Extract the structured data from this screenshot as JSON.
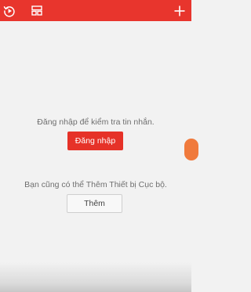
{
  "topbar": {
    "color": "#e8352d",
    "icons": {
      "left": "refresh-play-icon",
      "middle": "layout-grid-icon",
      "right": "plus-icon"
    }
  },
  "main": {
    "login_prompt": "Đăng nhập để kiểm tra tin nhắn.",
    "login_button": "Đăng nhập",
    "add_prompt": "Bạn cũng có thể Thêm Thiết bị Cục bộ.",
    "add_button": "Thêm"
  },
  "colors": {
    "accent": "#e63228",
    "side_handle": "#f07a3c"
  }
}
